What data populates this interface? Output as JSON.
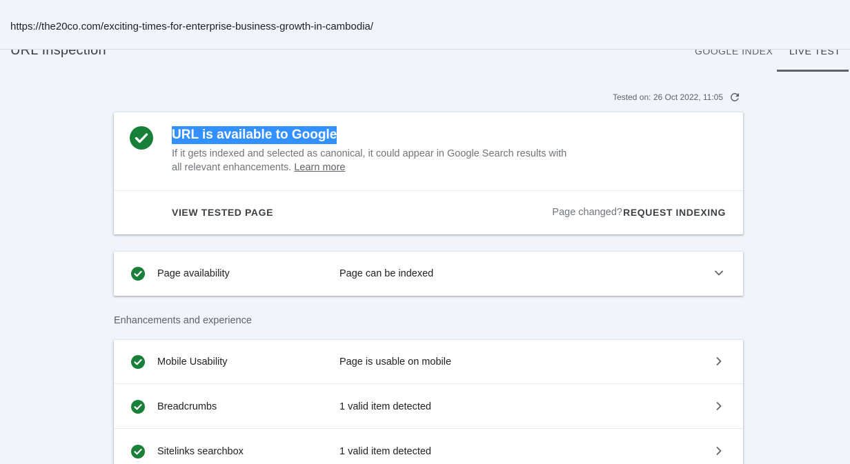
{
  "url_bar": {
    "url": "https://the20co.com/exciting-times-for-enterprise-business-growth-in-cambodia/"
  },
  "header": {
    "title": "URL Inspection",
    "tabs": [
      {
        "label": "GOOGLE INDEX",
        "active": false
      },
      {
        "label": "LIVE TEST",
        "active": true
      }
    ]
  },
  "tested_on": "Tested on: 26 Oct 2022, 11:05",
  "main_card": {
    "title": "URL is available to Google",
    "description": "If it gets indexed and selected as canonical, it could appear in Google Search results with all relevant enhancements.",
    "learn_more": "Learn more",
    "view_tested_page": "VIEW TESTED PAGE",
    "page_changed": "Page changed?",
    "request_indexing": "REQUEST INDEXING"
  },
  "availability": {
    "label": "Page availability",
    "value": "Page can be indexed"
  },
  "enhancements": {
    "section_label": "Enhancements and experience",
    "items": [
      {
        "label": "Mobile Usability",
        "value": "Page is usable on mobile"
      },
      {
        "label": "Breadcrumbs",
        "value": "1 valid item detected"
      },
      {
        "label": "Sitelinks searchbox",
        "value": "1 valid item detected"
      }
    ]
  },
  "colors": {
    "success_green": "#188038",
    "highlight_blue": "#3390ff",
    "background": "#f0f4fb"
  },
  "icons": {
    "status": "check-circle-icon",
    "refresh": "refresh-icon",
    "expand": "chevron-down-icon",
    "navigate": "chevron-right-icon"
  }
}
